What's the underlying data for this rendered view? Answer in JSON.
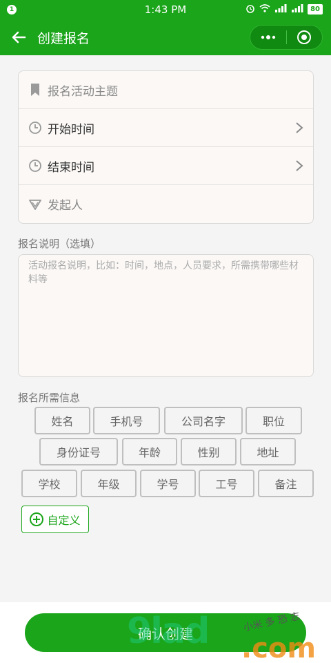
{
  "status_bar": {
    "notification_badge": "1",
    "time": "1:43 PM",
    "battery": "80"
  },
  "nav": {
    "title": "创建报名",
    "back_icon": "arrow-left-icon",
    "more_icon": "more-dots-icon",
    "close_icon": "target-circle-icon"
  },
  "form": {
    "topic_placeholder": "报名活动主题",
    "start_time_label": "开始时间",
    "end_time_label": "结束时间",
    "initiator_placeholder": "发起人"
  },
  "description": {
    "label": "报名说明（选填）",
    "placeholder": "活动报名说明，比如：时间，地点，人员要求，所需携带哪些材料等"
  },
  "required_info": {
    "label": "报名所需信息",
    "tags": [
      "姓名",
      "手机号",
      "公司名字",
      "职位",
      "身份证号",
      "年龄",
      "性别",
      "地址",
      "学校",
      "年级",
      "学号",
      "工号",
      "备注"
    ]
  },
  "custom_button": "自定义",
  "confirm_button": "确认创建",
  "watermark": {
    "main": "9lad",
    "domain": ".com",
    "tagline": "小米 多 恐 志"
  },
  "colors": {
    "brand_green": "#1aa51a",
    "card_bg": "#fbf8f6"
  }
}
